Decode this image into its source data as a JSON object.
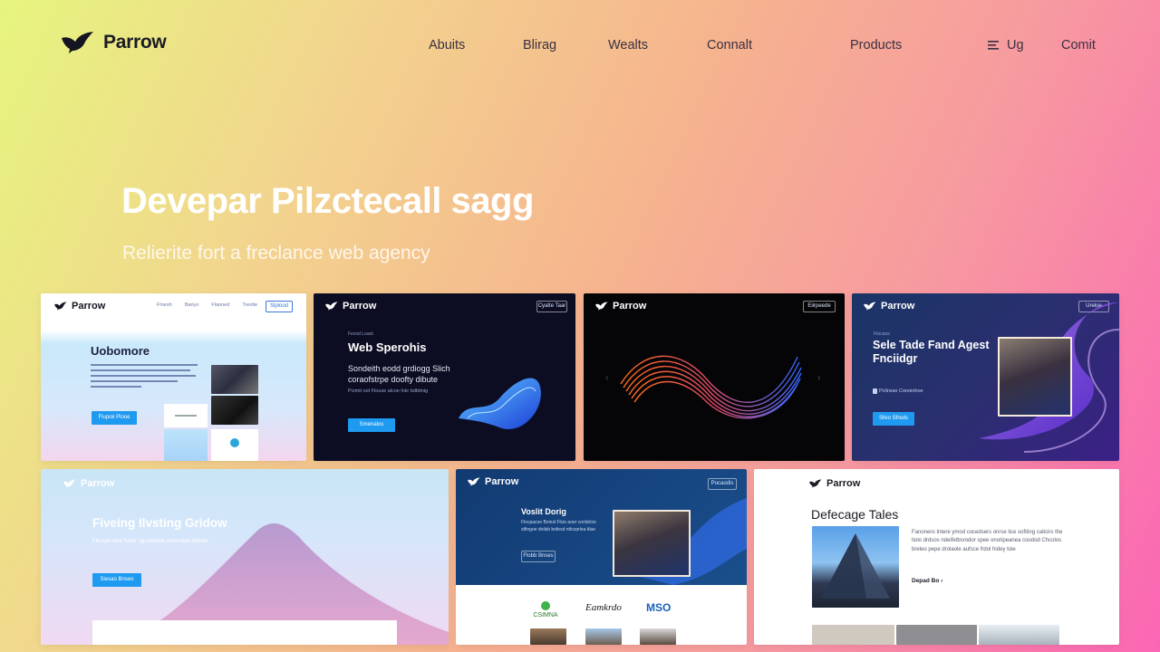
{
  "brand": {
    "name": "Parrow"
  },
  "nav": {
    "links": [
      "Abuits",
      "Blirag",
      "Wealts",
      "Connalt",
      "Products"
    ],
    "signup": "Ug",
    "cta": "Comit"
  },
  "hero": {
    "title": "Devepar Pilzctecall sagg",
    "subtitle": "Relierite fort a freclance web agency"
  },
  "cards": [
    {
      "logo": "Parrow",
      "heading": "Uobomore",
      "button": "Flupok Plooe",
      "nav": [
        "Flneoh",
        "Bariyo",
        "Flaoned",
        "Treolte",
        "Strelle"
      ],
      "cta": "Slplood"
    },
    {
      "logo": "Parrow",
      "eyebrow": "Fevod Loaot",
      "heading": "Web Sperohis",
      "body": "Sondeith eodd grdiogg Slich coraofstrpe doofty dibute",
      "note": "Pcimit ruit Flouse alcoe lnkr bdbtinig",
      "button": "Smenalos",
      "top_button": "Cyatte Taar"
    },
    {
      "logo": "Parrow",
      "top_button": "Eiirpeede"
    },
    {
      "logo": "Parrow",
      "eyebrow": "Ftocaos",
      "heading": "Sele Tade Fand Agest Fnciidgr",
      "body": "Pclinsse Conoinhoe",
      "button": "Sllvo Sfreds",
      "top_button": "Ureloe"
    },
    {
      "logo": "Parrow",
      "heading": "Fiveing Ilvsting Gridow",
      "body": "Flrcopo slne fvelor ogcoedaoe oolovdiae dbtnbe",
      "button": "Siesao Bnseo"
    },
    {
      "logo": "Parrow",
      "heading": "Voslit Dorig",
      "body": "Flocpacoe Boinsl Flcie aoer cordolcio stfingoe doilsb bofesd ntlcoprlea tilae",
      "button": "Flobb Bnses",
      "top_button": "Pocaodis",
      "brands": [
        "CSIMNA",
        "Eamkrdo",
        "MSO"
      ]
    },
    {
      "logo": "Parrow",
      "heading": "Defecage Tales",
      "body": "Fanonero Intere ymod cocedsers onrse lice sofiting caticirs the tiolo drdsos ndeifetbsrodor spee onoripeanea coodod Chcolos breleo pepe drolaole aufsce frdol hidey toie",
      "link": "Depad Bo ›"
    }
  ],
  "colors": {
    "accent": "#1e9af0",
    "dark": "#0c0d1e",
    "navy": "#14315f"
  }
}
